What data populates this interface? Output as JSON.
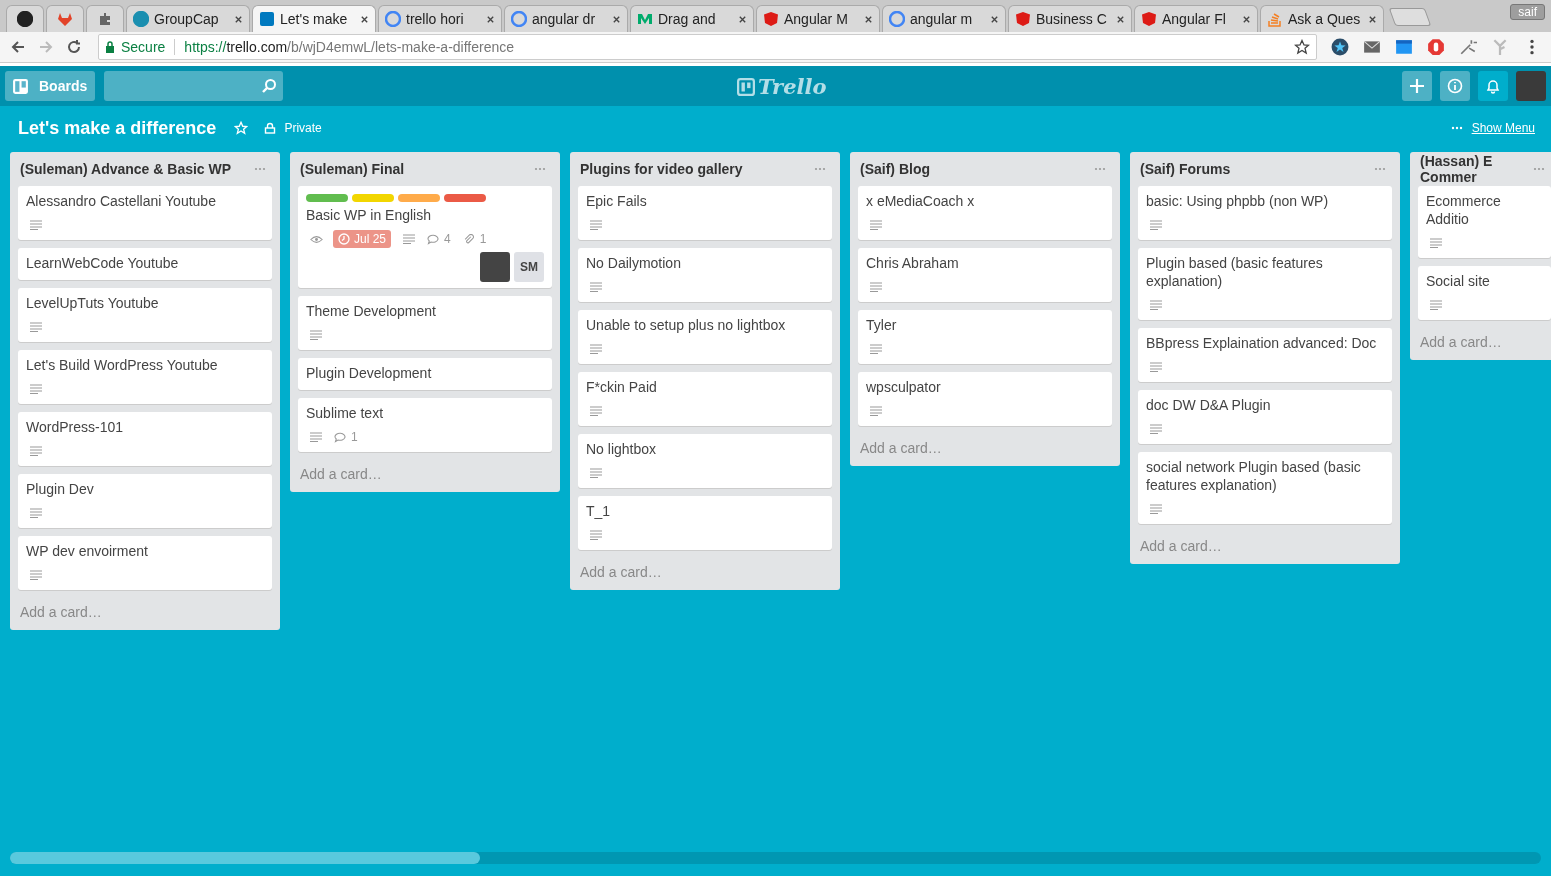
{
  "browser": {
    "tabs": [
      {
        "kind": "spotify",
        "selected": false
      },
      {
        "kind": "gitlab",
        "selected": false
      },
      {
        "kind": "puzzle",
        "selected": false
      },
      {
        "kind": "gc",
        "title": "GroupCap",
        "selected": false
      },
      {
        "kind": "trello",
        "title": "Let's make",
        "selected": true
      },
      {
        "kind": "google",
        "title": "trello hori",
        "selected": false
      },
      {
        "kind": "google",
        "title": "angular dr",
        "selected": false
      },
      {
        "kind": "medium",
        "title": "Drag and",
        "selected": false
      },
      {
        "kind": "angular",
        "title": "Angular M",
        "selected": false
      },
      {
        "kind": "google",
        "title": "angular m",
        "selected": false
      },
      {
        "kind": "angular",
        "title": "Business C",
        "selected": false
      },
      {
        "kind": "angular",
        "title": "Angular Fl",
        "selected": false
      },
      {
        "kind": "stack",
        "title": "Ask a Ques",
        "selected": false
      }
    ],
    "profile": "saif",
    "secure_label": "Secure",
    "url_scheme": "https://",
    "url_host": "trello.com",
    "url_path": "/b/wjD4emwL/lets-make-a-difference"
  },
  "header": {
    "boards_button": "Boards",
    "logo": "Trello"
  },
  "board": {
    "title": "Let's make a difference",
    "starred": false,
    "visibility": "Private",
    "menu_link": "Show Menu"
  },
  "lists": [
    {
      "title": "(Suleman) Advance & Basic WP",
      "add_card": "Add a card…",
      "cards": [
        {
          "title": "Alessandro Castellani Youtube",
          "description": true
        },
        {
          "title": "LearnWebCode Youtube",
          "description": false
        },
        {
          "title": "LevelUpTuts Youtube",
          "description": true
        },
        {
          "title": "Let's Build WordPress Youtube",
          "description": true
        },
        {
          "title": "WordPress-101",
          "description": true
        },
        {
          "title": "Plugin Dev",
          "description": true
        },
        {
          "title": "WP dev envoirment",
          "description": true
        }
      ]
    },
    {
      "title": "(Suleman) Final",
      "add_card": "Add a card…",
      "cards": [
        {
          "title": "Basic WP in English",
          "description": true,
          "labels": [
            {
              "color": "#61bd4f"
            },
            {
              "color": "#f2d600"
            },
            {
              "color": "#ffab4a"
            },
            {
              "color": "#eb5a46"
            }
          ],
          "watching": true,
          "due": "Jul 25",
          "comments": "4",
          "attachments": "1",
          "members": [
            {
              "kind": "photo"
            },
            {
              "kind": "initials",
              "initials": "SM"
            }
          ]
        },
        {
          "title": "Theme Development",
          "description": true
        },
        {
          "title": "Plugin Development",
          "description": false
        },
        {
          "title": "Sublime text",
          "description": true,
          "comments": "1"
        }
      ]
    },
    {
      "title": "Plugins for video gallery",
      "add_card": "Add a card…",
      "cards": [
        {
          "title": "Epic Fails",
          "description": true
        },
        {
          "title": "No Dailymotion",
          "description": true
        },
        {
          "title": "Unable to setup plus no lightbox",
          "description": true
        },
        {
          "title": "F*ckin Paid",
          "description": true
        },
        {
          "title": "No lightbox",
          "description": true
        },
        {
          "title": "T_1",
          "description": true
        }
      ]
    },
    {
      "title": "(Saif) Blog",
      "add_card": "Add a card…",
      "cards": [
        {
          "title": "x eMediaCoach x",
          "description": true
        },
        {
          "title": "Chris Abraham",
          "description": true
        },
        {
          "title": "Tyler",
          "description": true
        },
        {
          "title": "wpsculpator",
          "description": true
        }
      ]
    },
    {
      "title": "(Saif) Forums",
      "add_card": "Add a card…",
      "cards": [
        {
          "title": "basic: Using phpbb (non WP)",
          "description": true
        },
        {
          "title": "Plugin based (basic features explanation)",
          "description": true
        },
        {
          "title": "BBpress Explaination advanced: Doc",
          "description": true
        },
        {
          "title": "doc DW D&A Plugin",
          "description": true
        },
        {
          "title": "social network Plugin based (basic features explanation)",
          "description": true
        }
      ]
    },
    {
      "title": "(Hassan) E Commer",
      "add_card": "Add a card…",
      "cards": [
        {
          "title": "Ecommerce Additio",
          "description": true
        },
        {
          "title": "Social site",
          "description": true
        }
      ]
    }
  ]
}
